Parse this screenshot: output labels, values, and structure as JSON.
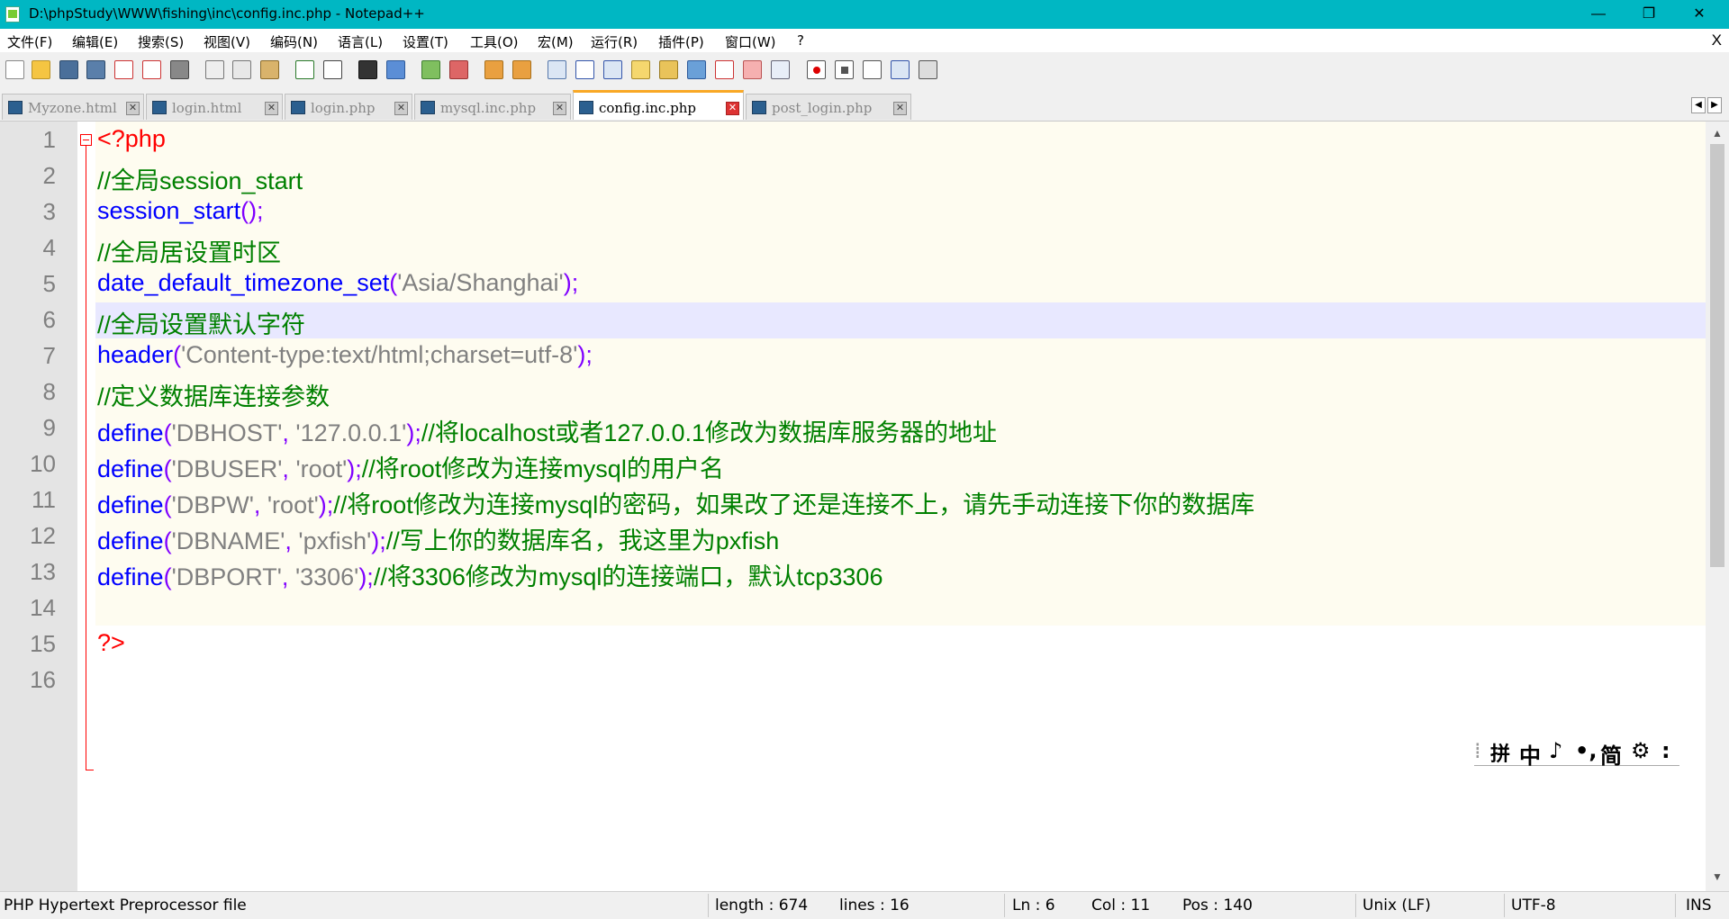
{
  "window": {
    "title": "D:\\phpStudy\\WWW\\fishing\\inc\\config.inc.php - Notepad++",
    "minimize": "—",
    "restore": "❐",
    "close": "✕"
  },
  "menu": [
    "文件(F)",
    "编辑(E)",
    "搜索(S)",
    "视图(V)",
    "编码(N)",
    "语言(L)",
    "设置(T)",
    "工具(O)",
    "宏(M)",
    "运行(R)",
    "插件(P)",
    "窗口(W)",
    "?"
  ],
  "menu_close": "X",
  "tabs": [
    {
      "label": "Myzone.html",
      "active": false
    },
    {
      "label": "login.html",
      "active": false
    },
    {
      "label": "login.php",
      "active": false
    },
    {
      "label": "mysql.inc.php",
      "active": false
    },
    {
      "label": "config.inc.php",
      "active": true
    },
    {
      "label": "post_login.php",
      "active": false
    }
  ],
  "code_lines": [
    {
      "n": "1",
      "parts": [
        {
          "t": "<?php",
          "c": "ph"
        }
      ]
    },
    {
      "n": "2",
      "parts": [
        {
          "t": "//全局session_start",
          "c": "cm"
        }
      ]
    },
    {
      "n": "3",
      "parts": [
        {
          "t": "session_start",
          "c": "kw"
        },
        {
          "t": "();",
          "c": "pu"
        }
      ]
    },
    {
      "n": "4",
      "parts": [
        {
          "t": "//全局居设置时区",
          "c": "cm"
        }
      ]
    },
    {
      "n": "5",
      "parts": [
        {
          "t": "date_default_timezone_set",
          "c": "kw"
        },
        {
          "t": "(",
          "c": "pu"
        },
        {
          "t": "'Asia/Shanghai'",
          "c": "st"
        },
        {
          "t": ");",
          "c": "pu"
        }
      ]
    },
    {
      "n": "6",
      "parts": [
        {
          "t": "//全局设置默认字符",
          "c": "cm"
        }
      ]
    },
    {
      "n": "7",
      "parts": [
        {
          "t": "header",
          "c": "kw"
        },
        {
          "t": "(",
          "c": "pu"
        },
        {
          "t": "'Content-type:text/html;charset=utf-8'",
          "c": "st"
        },
        {
          "t": ");",
          "c": "pu"
        }
      ]
    },
    {
      "n": "8",
      "parts": [
        {
          "t": "//定义数据库连接参数",
          "c": "cm"
        }
      ]
    },
    {
      "n": "9",
      "parts": [
        {
          "t": "define",
          "c": "kw"
        },
        {
          "t": "(",
          "c": "pu"
        },
        {
          "t": "'DBHOST'",
          "c": "st"
        },
        {
          "t": ", ",
          "c": "pu"
        },
        {
          "t": "'127.0.0.1'",
          "c": "st"
        },
        {
          "t": ");",
          "c": "pu"
        },
        {
          "t": "//将localhost或者127.0.0.1修改为数据库服务器的地址",
          "c": "cm"
        }
      ]
    },
    {
      "n": "10",
      "parts": [
        {
          "t": "define",
          "c": "kw"
        },
        {
          "t": "(",
          "c": "pu"
        },
        {
          "t": "'DBUSER'",
          "c": "st"
        },
        {
          "t": ", ",
          "c": "pu"
        },
        {
          "t": "'root'",
          "c": "st"
        },
        {
          "t": ");",
          "c": "pu"
        },
        {
          "t": "//将root修改为连接mysql的用户名",
          "c": "cm"
        }
      ]
    },
    {
      "n": "11",
      "parts": [
        {
          "t": "define",
          "c": "kw"
        },
        {
          "t": "(",
          "c": "pu"
        },
        {
          "t": "'DBPW'",
          "c": "st"
        },
        {
          "t": ", ",
          "c": "pu"
        },
        {
          "t": "'root'",
          "c": "st"
        },
        {
          "t": ");",
          "c": "pu"
        },
        {
          "t": "//将root修改为连接mysql的密码，如果改了还是连接不上，请先手动连接下你的数据库",
          "c": "cm"
        }
      ]
    },
    {
      "n": "12",
      "parts": [
        {
          "t": "define",
          "c": "kw"
        },
        {
          "t": "(",
          "c": "pu"
        },
        {
          "t": "'DBNAME'",
          "c": "st"
        },
        {
          "t": ", ",
          "c": "pu"
        },
        {
          "t": "'pxfish'",
          "c": "st"
        },
        {
          "t": ");",
          "c": "pu"
        },
        {
          "t": "//写上你的数据库名，我这里为pxfish",
          "c": "cm"
        }
      ]
    },
    {
      "n": "13",
      "parts": [
        {
          "t": "define",
          "c": "kw"
        },
        {
          "t": "(",
          "c": "pu"
        },
        {
          "t": "'DBPORT'",
          "c": "st"
        },
        {
          "t": ", ",
          "c": "pu"
        },
        {
          "t": "'3306'",
          "c": "st"
        },
        {
          "t": ");",
          "c": "pu"
        },
        {
          "t": "//将3306修改为mysql的连接端口，默认tcp3306",
          "c": "cm"
        }
      ]
    },
    {
      "n": "14",
      "parts": []
    },
    {
      "n": "15",
      "parts": [
        {
          "t": "?>",
          "c": "ph"
        }
      ]
    },
    {
      "n": "16",
      "parts": []
    }
  ],
  "ime": [
    "拼",
    "中",
    "♪",
    "•,",
    "简",
    "⚙",
    ":"
  ],
  "status": {
    "file_type": "PHP Hypertext Preprocessor file",
    "length": "length : 674",
    "lines": "lines : 16",
    "ln": "Ln : 6",
    "col": "Col : 11",
    "pos": "Pos : 140",
    "eol": "Unix (LF)",
    "encoding": "UTF-8",
    "mode": "INS"
  }
}
